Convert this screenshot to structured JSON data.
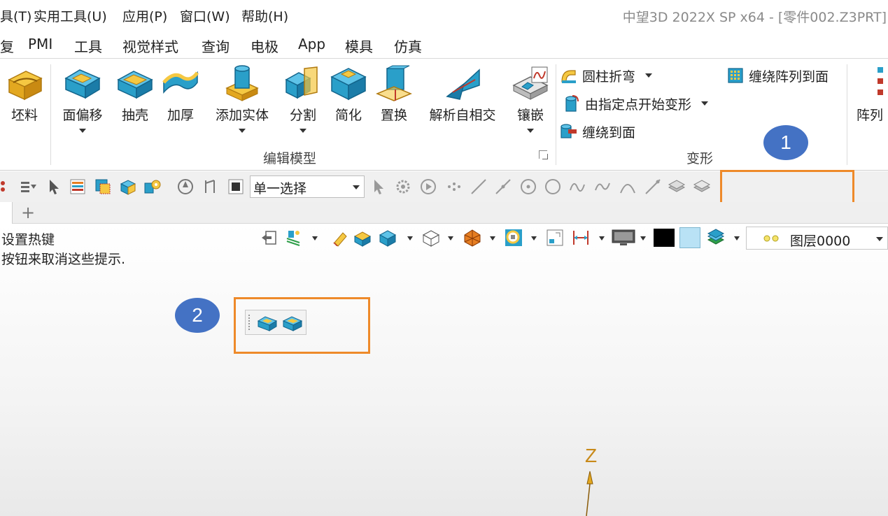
{
  "menubar": {
    "items": [
      "具(T)",
      "实用工具(U)",
      "应用(P)",
      "窗口(W)",
      "帮助(H)"
    ],
    "title": "中望3D 2022X SP x64 - [零件002.Z3PRT]"
  },
  "ribbon_tabs": [
    "复",
    "PMI",
    "工具",
    "视觉样式",
    "查询",
    "电极",
    "App",
    "模具",
    "仿真"
  ],
  "ribbon": {
    "edit_model": {
      "buttons": [
        "坯料",
        "面偏移",
        "抽壳",
        "加厚",
        "添加实体",
        "分割",
        "简化",
        "置换",
        "解析自相交",
        "镶嵌"
      ],
      "group_label": "编辑模型"
    },
    "deform": {
      "items": [
        "圆柱折弯",
        "由指定点开始变形",
        "缠绕到面",
        "缠绕阵列到面"
      ],
      "group_label": "变形"
    },
    "array_label": "阵列"
  },
  "callouts": [
    "1",
    "2"
  ],
  "command_bar": {
    "selection_mode": "单一选择"
  },
  "doc_tabs": {
    "add_label": "+"
  },
  "hints": [
    "设置热键",
    "按钮来取消这些提示."
  ],
  "layer": {
    "name": "图层0000"
  },
  "axis": {
    "z_label": "Z"
  },
  "colors": {
    "accent_orange": "#ee8a2a",
    "callout_blue": "#4472c4",
    "icon_teal": "#2a9fc9"
  }
}
